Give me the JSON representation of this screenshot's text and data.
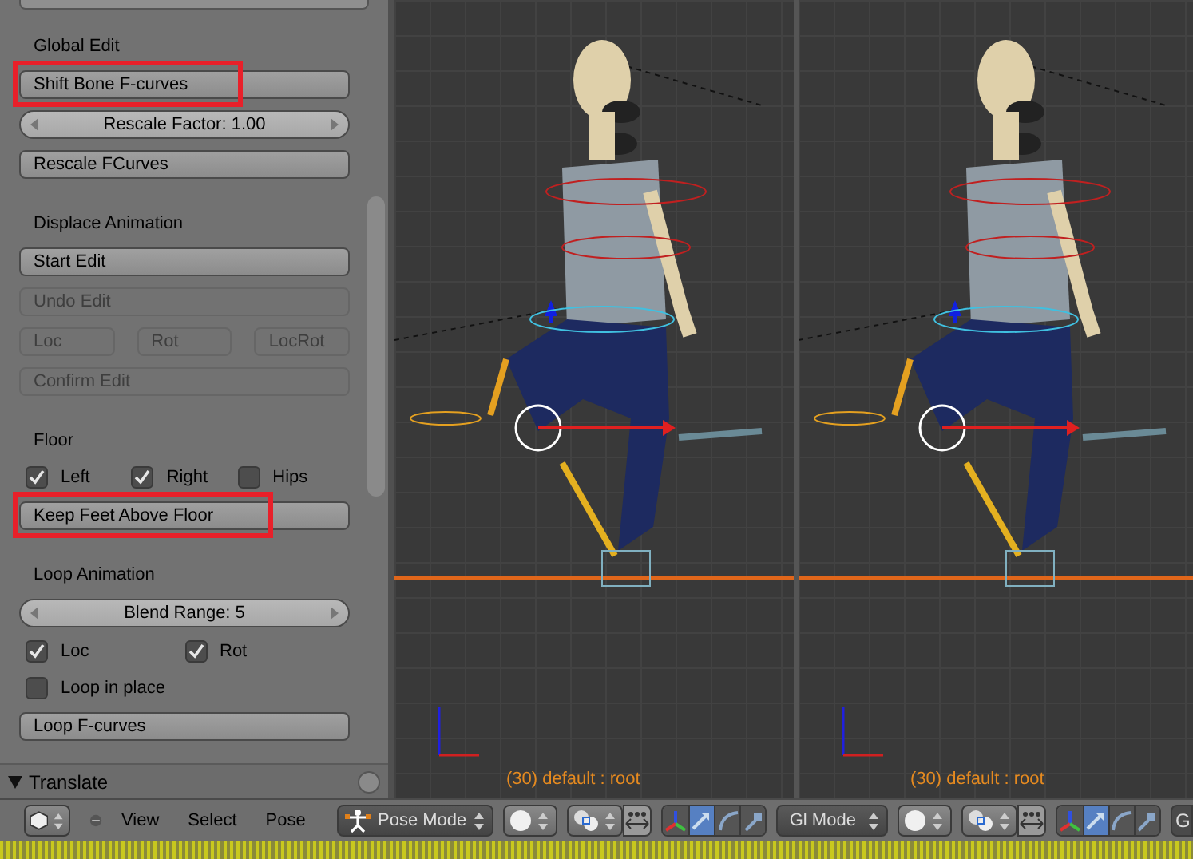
{
  "tool_panel": {
    "sections": [
      {
        "heading": "Global Edit",
        "items": [
          {
            "kind": "button",
            "label": "Shift Bone F-curves",
            "disabled": false,
            "highlighted": true
          },
          {
            "kind": "slider",
            "label": "Rescale Factor: 1.00"
          },
          {
            "kind": "button",
            "label": "Rescale FCurves",
            "disabled": false,
            "highlighted": false
          }
        ]
      },
      {
        "heading": "Displace Animation",
        "items": [
          {
            "kind": "button",
            "label": "Start Edit",
            "disabled": false,
            "highlighted": false
          },
          {
            "kind": "button",
            "label": "Undo Edit",
            "disabled": true,
            "highlighted": false
          },
          {
            "kind": "button_row",
            "buttons": [
              {
                "label": "Loc",
                "disabled": true
              },
              {
                "label": "Rot",
                "disabled": true
              },
              {
                "label": "LocRot",
                "disabled": true
              }
            ]
          },
          {
            "kind": "button",
            "label": "Confirm Edit",
            "disabled": true,
            "highlighted": false
          }
        ]
      },
      {
        "heading": "Floor",
        "items": [
          {
            "kind": "checks",
            "checks": [
              {
                "label": "Left",
                "checked": true
              },
              {
                "label": "Right",
                "checked": true
              },
              {
                "label": "Hips",
                "checked": false
              }
            ]
          },
          {
            "kind": "button",
            "label": "Keep Feet Above Floor",
            "disabled": false,
            "highlighted": true
          }
        ]
      },
      {
        "heading": "Loop Animation",
        "items": [
          {
            "kind": "slider",
            "label": "Blend Range: 5"
          },
          {
            "kind": "checks",
            "checks": [
              {
                "label": "Loc",
                "checked": true
              },
              {
                "label": "Rot",
                "checked": true
              }
            ]
          },
          {
            "kind": "checks",
            "checks": [
              {
                "label": "Loop in place",
                "checked": false
              }
            ]
          },
          {
            "kind": "button",
            "label": "Loop F-curves",
            "disabled": false,
            "highlighted": false
          }
        ]
      }
    ],
    "collapsed_panel": {
      "title": "Translate",
      "expanded": true
    }
  },
  "viewports": [
    {
      "overlay_text": "(30) default : root"
    },
    {
      "overlay_text": "(30) default : root"
    }
  ],
  "header": {
    "menus": [
      "View",
      "Select",
      "Pose"
    ],
    "mode": "Pose Mode",
    "groups": [
      {
        "manipulators": [
          {
            "kind": "translate",
            "selected": true
          },
          {
            "kind": "rotate",
            "selected": false
          },
          {
            "kind": "scale",
            "selected": false
          }
        ],
        "mode_after": "Gl Mode"
      },
      {
        "manipulators": [
          {
            "kind": "translate",
            "selected": true
          },
          {
            "kind": "rotate",
            "selected": false
          },
          {
            "kind": "scale",
            "selected": false
          }
        ],
        "mode_after": "G"
      }
    ]
  }
}
